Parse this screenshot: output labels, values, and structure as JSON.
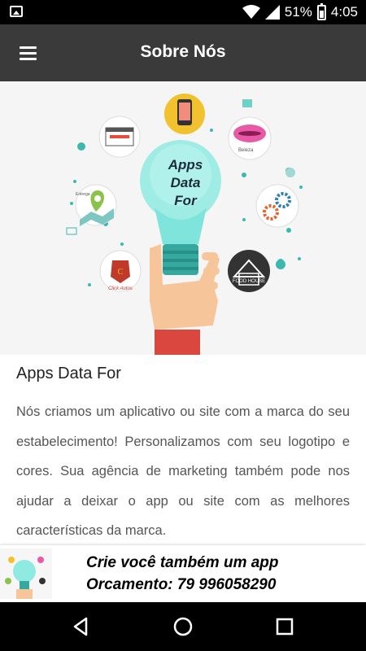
{
  "status_bar": {
    "battery": "51%",
    "time": "4:05",
    "icons": [
      "image-icon",
      "wifi-icon",
      "signal-icon",
      "battery-charging-icon"
    ]
  },
  "app_bar": {
    "title": "Sobre Nós",
    "menu_icon": "hamburger-menu-icon"
  },
  "hero": {
    "bulb_text": [
      "Apps",
      "Data",
      "For"
    ],
    "labels": [
      "Click",
      "Beleza",
      "Click Autos",
      "Entrega",
      "FOOD HOUSE"
    ],
    "icons": [
      "phone-icon",
      "lips-icon",
      "gears-icon",
      "house-icon",
      "car-badge-icon",
      "map-pin-icon",
      "browser-icon",
      "hand-bulb-icon"
    ]
  },
  "content": {
    "heading": "Apps Data For",
    "body": "Nós criamos um aplicativo ou site com a marca do seu estabelecimento! Personalizamos com seu logotipo e cores. Sua agência de marketing também pode nos ajudar a deixar o app ou site com as melhores características da marca."
  },
  "banner": {
    "line1": "Crie você também um app",
    "line2": "Orcamento: 79 996058290"
  },
  "nav_bar": {
    "buttons": [
      "back-icon",
      "home-icon",
      "recents-icon"
    ]
  },
  "colors": {
    "app_bar": "#3a3a3a",
    "status_bar": "#000000",
    "bulb": "#6fe0d8",
    "hand_sleeve": "#d9473f"
  }
}
